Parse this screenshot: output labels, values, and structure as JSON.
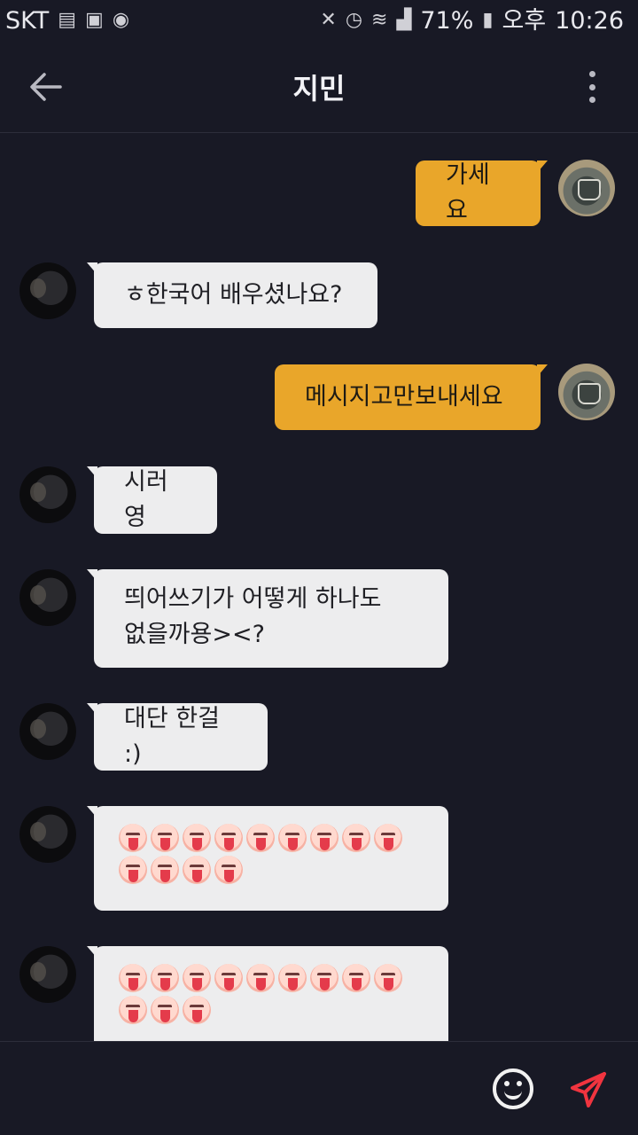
{
  "status_bar": {
    "carrier": "SKT",
    "battery": "71%",
    "ampm": "오후",
    "time": "10:26",
    "left_icons": [
      "notification-icon",
      "gallery-icon",
      "chrome-icon"
    ],
    "right_icons": [
      "mute-icon",
      "alarm-icon",
      "wifi-icon",
      "signal-icon",
      "battery-icon"
    ]
  },
  "header": {
    "title": "지민"
  },
  "colors": {
    "background": "#181925",
    "my_bubble": "#e9a62a",
    "other_bubble": "#ededee",
    "send_accent": "#f0343f"
  },
  "messages": [
    {
      "sender": "me",
      "text": "가세요"
    },
    {
      "sender": "other",
      "text": "ㅎ한국어 배우셨나요?"
    },
    {
      "sender": "me",
      "text": "메시지고만보내세요"
    },
    {
      "sender": "other",
      "text": "시러영"
    },
    {
      "sender": "other",
      "line1": "띄어쓰기가 어떻게 하나도",
      "line2": "없을까용><?"
    },
    {
      "sender": "other",
      "text": "대단 한걸 :)"
    },
    {
      "sender": "other",
      "emoji": "tongue-out-wink",
      "count": 13
    },
    {
      "sender": "other",
      "emoji": "tongue-out-wink",
      "count": 12
    }
  ]
}
